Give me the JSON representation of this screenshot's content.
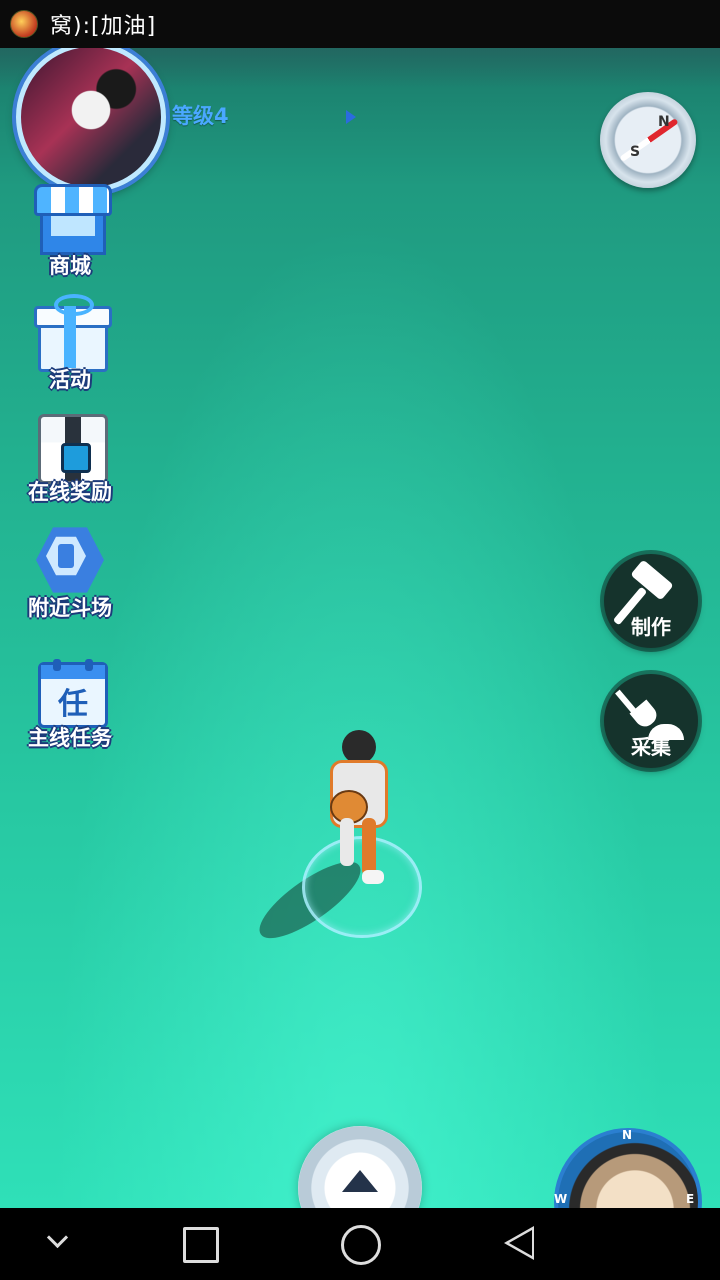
{
  "status_bar": {
    "app_icon": "game-app-icon",
    "notification_text": "窝):[加油]"
  },
  "hud": {
    "level_label": "等级4",
    "compass": {
      "north": "N",
      "south": "S"
    }
  },
  "side_menu": {
    "items": [
      {
        "id": "shop",
        "label": "商城",
        "icon": "shop-icon"
      },
      {
        "id": "events",
        "label": "活动",
        "icon": "gift-icon"
      },
      {
        "id": "online-reward",
        "label": "在线奖励",
        "icon": "chest-icon"
      },
      {
        "id": "nearby-arena",
        "label": "附近斗场",
        "icon": "arena-icon"
      },
      {
        "id": "main-quest",
        "label": "主线任务",
        "icon": "calendar-icon",
        "glyph": "任"
      }
    ]
  },
  "actions": {
    "craft_label": "制作",
    "gather_label": "采集"
  },
  "minimap": {
    "n": "N",
    "w": "W",
    "e": "E"
  },
  "colors": {
    "accent": "#2b7fd0",
    "ground_top": "#1b7a6a",
    "ground_bottom": "#2fe0b8",
    "action_button_bg": "#15332c"
  }
}
